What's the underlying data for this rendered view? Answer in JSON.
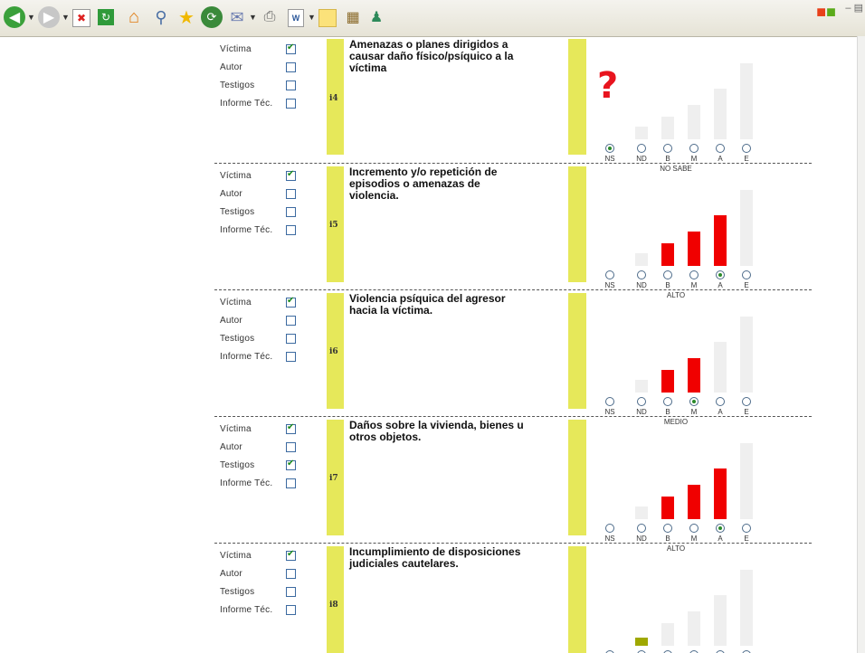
{
  "toolbar": {
    "icons": [
      "back-icon",
      "forward-icon",
      "stop-icon",
      "refresh-icon",
      "home-icon",
      "search-icon",
      "favorites-icon",
      "history-icon",
      "mail-icon",
      "print-icon",
      "edit-word-icon",
      "notes-icon",
      "research-icon",
      "messenger-icon"
    ]
  },
  "sources": [
    "Víctima",
    "Autor",
    "Testigos",
    "Informe Téc."
  ],
  "radio_labels": [
    "NS",
    "ND",
    "B",
    "M",
    "A",
    "E"
  ],
  "colors": {
    "accent_yellow": "#e6e85a",
    "bar_red": "#f00000",
    "bar_gray": "#efefef",
    "bar_olive": "#9fa800",
    "question_red": "#e8141e"
  },
  "items": [
    {
      "id": "i4",
      "text": "Amenazas o planes dirigidos a causar daño físico/psíquico a la víctima",
      "checked": [
        true,
        false,
        false,
        false
      ],
      "selected": 0,
      "level": "NO SABE",
      "bars": [
        "none",
        "gray",
        "gray",
        "gray",
        "gray",
        "gray"
      ]
    },
    {
      "id": "i5",
      "text": "Incremento y/o repetición de episodios o amenazas de violencia.",
      "checked": [
        true,
        false,
        false,
        false
      ],
      "selected": 4,
      "level": "ALTO",
      "bars": [
        "none",
        "gray",
        "red",
        "red",
        "red",
        "gray"
      ]
    },
    {
      "id": "i6",
      "text": "Violencia psíquica del agresor hacia la víctima.",
      "checked": [
        true,
        false,
        false,
        false
      ],
      "selected": 3,
      "level": "MEDIO",
      "bars": [
        "none",
        "gray",
        "red",
        "red",
        "gray",
        "gray"
      ]
    },
    {
      "id": "i7",
      "text": "Daños sobre la vivienda, bienes u otros objetos.",
      "checked": [
        true,
        false,
        true,
        false
      ],
      "selected": 4,
      "level": "ALTO",
      "bars": [
        "none",
        "gray",
        "red",
        "red",
        "red",
        "gray"
      ]
    },
    {
      "id": "i8",
      "text": "Incumplimiento de disposiciones judiciales cautelares.",
      "checked": [
        true,
        false,
        false,
        false
      ],
      "selected": 1,
      "level": "",
      "bars": [
        "none",
        "olive",
        "gray",
        "gray",
        "gray",
        "gray"
      ]
    }
  ]
}
